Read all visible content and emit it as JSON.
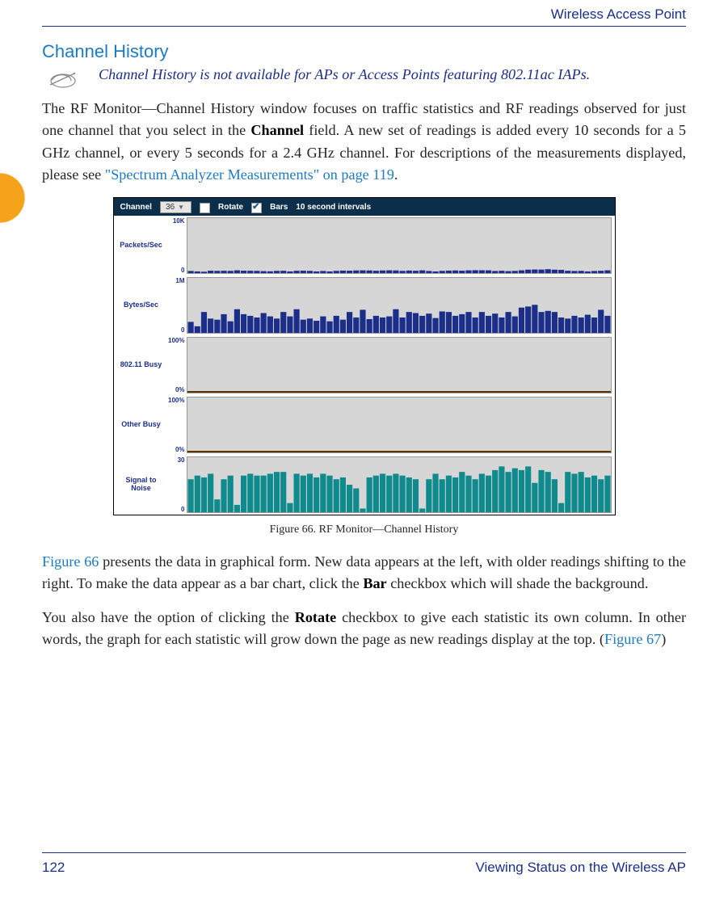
{
  "header": {
    "product": "Wireless Access Point"
  },
  "section": {
    "title": "Channel History"
  },
  "note": {
    "text": "Channel History is not available for APs or Access Points featuring 802.11ac IAPs."
  },
  "para1": {
    "pre": "The RF Monitor—Channel History window focuses on traffic statistics and RF readings observed for just one channel that you select in the ",
    "b1": "Channel",
    "mid1": " field. A new set of readings is added every 10 seconds for a 5 GHz channel, or every 5 seconds for a 2.4 GHz channel. For descriptions of the measurements displayed, please see ",
    "link": "\"Spectrum Analyzer Measurements\" on page 119",
    "post": "."
  },
  "figure": {
    "toolbar": {
      "channel_label": "Channel",
      "channel_value": "36",
      "rotate_label": "Rotate",
      "bars_label": "Bars",
      "interval_label": "10 second intervals"
    },
    "rows": [
      {
        "label": "Packets/Sec",
        "top": "10K",
        "bot": "0"
      },
      {
        "label": "Bytes/Sec",
        "top": "1M",
        "bot": "0"
      },
      {
        "label": "802.11 Busy",
        "top": "100%",
        "bot": "0%"
      },
      {
        "label": "Other Busy",
        "top": "100%",
        "bot": "0%"
      },
      {
        "label": "Signal to Noise",
        "top": "30",
        "bot": "0"
      }
    ],
    "caption": "Figure 66. RF Monitor—Channel History"
  },
  "para2": {
    "link": "Figure 66",
    "mid": " presents the data in graphical form. New data appears at the left, with older readings shifting to the right. To make the data appear as a bar chart, click the ",
    "b1": "Bar",
    "post": " checkbox which will shade the background."
  },
  "para3": {
    "pre": "You also have the option of clicking the ",
    "b1": "Rotate",
    "mid": " checkbox to give each statistic its own column. In other words, the graph for each statistic will grow down the page as new readings display at the top. (",
    "link": "Figure 67",
    "post": ")"
  },
  "footer": {
    "page": "122",
    "section": "Viewing Status on the Wireless AP"
  },
  "chart_data": [
    {
      "metric": "Packets/Sec",
      "type": "bar",
      "ylim": [
        0,
        10000
      ],
      "values": [
        380,
        300,
        250,
        430,
        400,
        420,
        400,
        500,
        430,
        420,
        400,
        350,
        320,
        400,
        420,
        300,
        420,
        430,
        400,
        300,
        380,
        300,
        400,
        450,
        430,
        480,
        500,
        480,
        420,
        480,
        500,
        480,
        400,
        460,
        420,
        500,
        380,
        300,
        400,
        450,
        480,
        430,
        500,
        520,
        510,
        500,
        380,
        420,
        350,
        400,
        500,
        620,
        650,
        640,
        700,
        620,
        580,
        420,
        380,
        400,
        300,
        380,
        420,
        500
      ],
      "series_color": "#1b2e8a"
    },
    {
      "metric": "Bytes/Sec",
      "type": "bar",
      "ylim": [
        0,
        1000000
      ],
      "values": [
        200000,
        120000,
        380000,
        260000,
        240000,
        340000,
        210000,
        430000,
        340000,
        310000,
        280000,
        360000,
        300000,
        260000,
        380000,
        300000,
        430000,
        240000,
        260000,
        220000,
        300000,
        210000,
        310000,
        240000,
        380000,
        280000,
        420000,
        250000,
        310000,
        280000,
        300000,
        430000,
        280000,
        380000,
        360000,
        310000,
        350000,
        270000,
        390000,
        380000,
        310000,
        340000,
        380000,
        280000,
        380000,
        310000,
        350000,
        280000,
        380000,
        300000,
        460000,
        480000,
        510000,
        380000,
        400000,
        380000,
        280000,
        260000,
        310000,
        280000,
        330000,
        280000,
        420000,
        310000
      ],
      "series_color": "#1b2e8a"
    },
    {
      "metric": "802.11 Busy",
      "type": "line",
      "ylim": [
        0,
        100
      ],
      "values": [
        1,
        1,
        1,
        1,
        1,
        1,
        1,
        1,
        1,
        1,
        1,
        1,
        1,
        1,
        1,
        1,
        1,
        1,
        1,
        1,
        1,
        1,
        1,
        1,
        1,
        1,
        1,
        1,
        1,
        1,
        1,
        1,
        1,
        1,
        1,
        1,
        1,
        1,
        1,
        1,
        1,
        1,
        1,
        1,
        1,
        1,
        1,
        1,
        1,
        1,
        1,
        1,
        1,
        1,
        1,
        1,
        1,
        1,
        1,
        1,
        1,
        1,
        1,
        1
      ],
      "series_color": "#b00000"
    },
    {
      "metric": "Other Busy",
      "type": "line",
      "ylim": [
        0,
        100
      ],
      "values": [
        0,
        0,
        0,
        0,
        0,
        0,
        0,
        0,
        0,
        0,
        0,
        0,
        0,
        0,
        0,
        0,
        0,
        0,
        0,
        0,
        0,
        0,
        0,
        0,
        0,
        0,
        0,
        0,
        0,
        0,
        0,
        0,
        0,
        0,
        0,
        0,
        0,
        0,
        0,
        0,
        0,
        0,
        0,
        0,
        0,
        0,
        0,
        0,
        0,
        0,
        0,
        0,
        0,
        0,
        0,
        0,
        0,
        0,
        0,
        0,
        0,
        0,
        0,
        0
      ],
      "series_color": "#006400"
    },
    {
      "metric": "Signal to Noise",
      "type": "bar",
      "ylim": [
        0,
        30
      ],
      "values": [
        18,
        20,
        19,
        21,
        7,
        18,
        20,
        4,
        20,
        21,
        20,
        20,
        21,
        22,
        22,
        5,
        21,
        20,
        21,
        19,
        21,
        20,
        18,
        19,
        15,
        13,
        2,
        19,
        20,
        21,
        20,
        21,
        20,
        19,
        18,
        2,
        18,
        21,
        18,
        20,
        19,
        22,
        20,
        18,
        21,
        20,
        23,
        25,
        22,
        24,
        23,
        25,
        16,
        23,
        22,
        18,
        5,
        22,
        21,
        22,
        19,
        20,
        18,
        20
      ],
      "series_color": "#0f8b8d"
    }
  ]
}
